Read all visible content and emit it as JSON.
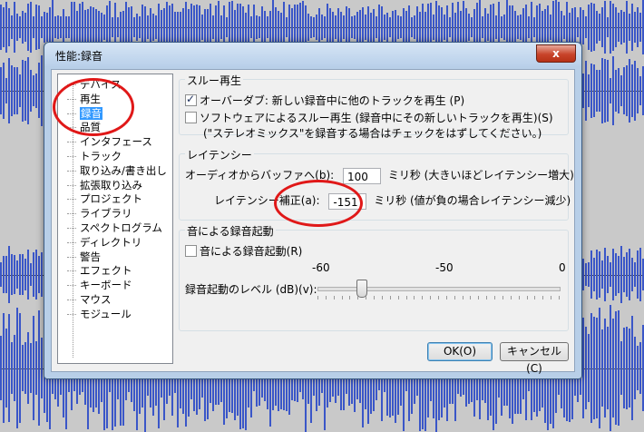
{
  "window": {
    "title": "性能:録音",
    "close_glyph": "x"
  },
  "tree": {
    "items": [
      {
        "label": "デバイス",
        "selected": false
      },
      {
        "label": "再生",
        "selected": false
      },
      {
        "label": "録音",
        "selected": true
      },
      {
        "label": "品質",
        "selected": false
      },
      {
        "label": "インタフェース",
        "selected": false
      },
      {
        "label": "トラック",
        "selected": false
      },
      {
        "label": "取り込み/書き出し",
        "selected": false
      },
      {
        "label": "拡張取り込み",
        "selected": false
      },
      {
        "label": "プロジェクト",
        "selected": false
      },
      {
        "label": "ライブラリ",
        "selected": false
      },
      {
        "label": "スペクトログラム",
        "selected": false
      },
      {
        "label": "ディレクトリ",
        "selected": false
      },
      {
        "label": "警告",
        "selected": false
      },
      {
        "label": "エフェクト",
        "selected": false
      },
      {
        "label": "キーボード",
        "selected": false
      },
      {
        "label": "マウス",
        "selected": false
      },
      {
        "label": "モジュール",
        "selected": false
      }
    ]
  },
  "playthrough": {
    "title": "スルー再生",
    "overdub_label": "オーバーダブ: 新しい録音中に他のトラックを再生 (P)",
    "overdub_checked": true,
    "software_label": "ソフトウェアによるスルー再生 (録音中にその新しいトラックを再生)(S)",
    "software_checked": false,
    "note": "(\"ステレオミックス\"を録音する場合はチェックをはずしてください。)"
  },
  "latency": {
    "title": "レイテンシー",
    "buffer_label": "オーディオからバッファへ(b):",
    "buffer_value": "100",
    "buffer_unit": "ミリ秒 (大きいほどレイテンシー増大)",
    "correction_label": "レイテンシー補正(a):",
    "correction_value": "-151",
    "correction_unit": "ミリ秒 (値が負の場合レイテンシー減少)"
  },
  "sound_activated": {
    "title": "音による録音起動",
    "checkbox_label": "音による録音起動(R)",
    "checked": false,
    "scale_labels": [
      "-60",
      "-50",
      "0"
    ],
    "level_label": "録音起動のレベル (dB)(v):",
    "level_fraction": 0.18
  },
  "buttons": {
    "ok": "OK(O)",
    "cancel": "キャンセル(C)"
  },
  "colors": {
    "selection": "#3399ff",
    "annotation": "#e01818",
    "waveform": "#3a56c8"
  }
}
